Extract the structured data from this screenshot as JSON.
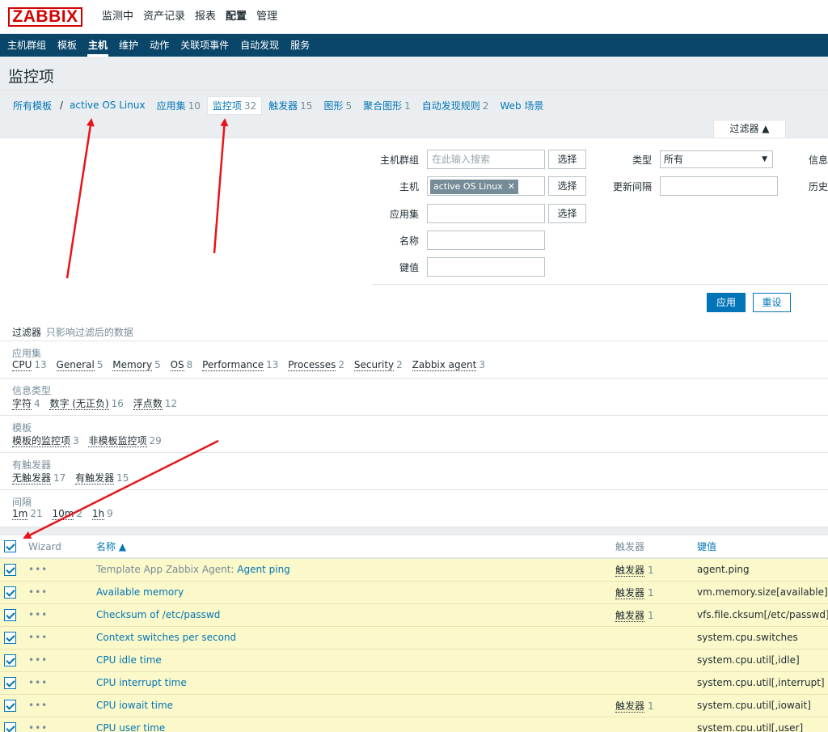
{
  "top": {
    "logo": "ZABBIX",
    "menu": [
      "监测中",
      "资产记录",
      "报表",
      "配置",
      "管理"
    ],
    "selected_menu": "配置"
  },
  "subnav": {
    "items": [
      "主机群组",
      "模板",
      "主机",
      "维护",
      "动作",
      "关联项事件",
      "自动发现",
      "服务"
    ],
    "selected": "主机"
  },
  "page": {
    "title": "监控项"
  },
  "breadcrumbs": {
    "all_templates": "所有模板",
    "separator": "/",
    "host": "active OS Linux",
    "tabs": [
      {
        "label": "应用集",
        "count": "10"
      },
      {
        "label": "监控项",
        "count": "32"
      },
      {
        "label": "触发器",
        "count": "15"
      },
      {
        "label": "图形",
        "count": "5"
      },
      {
        "label": "聚合图形",
        "count": "1"
      },
      {
        "label": "自动发现规则",
        "count": "2"
      },
      {
        "label": "Web 场景",
        "count": ""
      }
    ]
  },
  "filter": {
    "tab_label": "过滤器 ▲",
    "host_group_label": "主机群组",
    "host_group_placeholder": "在此输入搜索",
    "select_label": "选择",
    "host_label": "主机",
    "host_tag": "active OS Linux",
    "app_label": "应用集",
    "name_label": "名称",
    "key_label": "键值",
    "type_label": "类型",
    "type_value": "所有",
    "interval_label": "更新间隔",
    "info_label_cut": "信息",
    "history_label_cut": "历史",
    "apply": "应用",
    "reset": "重设"
  },
  "subfilter": {
    "title": "过滤器",
    "note": "只影响过滤后的数据",
    "groups": [
      {
        "label": "应用集",
        "items": [
          {
            "name": "CPU",
            "count": "13"
          },
          {
            "name": "General",
            "count": "5"
          },
          {
            "name": "Memory",
            "count": "5"
          },
          {
            "name": "OS",
            "count": "8"
          },
          {
            "name": "Performance",
            "count": "13"
          },
          {
            "name": "Processes",
            "count": "2"
          },
          {
            "name": "Security",
            "count": "2"
          },
          {
            "name": "Zabbix agent",
            "count": "3"
          }
        ]
      },
      {
        "label": "信息类型",
        "items": [
          {
            "name": "字符",
            "count": "4"
          },
          {
            "name": "数字 (无正负)",
            "count": "16"
          },
          {
            "name": "浮点数",
            "count": "12"
          }
        ]
      },
      {
        "label": "模板",
        "items": [
          {
            "name": "模板的监控项",
            "count": "3"
          },
          {
            "name": "非模板监控项",
            "count": "29"
          }
        ]
      },
      {
        "label": "有触发器",
        "items": [
          {
            "name": "无触发器",
            "count": "17"
          },
          {
            "name": "有触发器",
            "count": "15"
          }
        ]
      },
      {
        "label": "间隔",
        "items": [
          {
            "name": "1m",
            "count": "21"
          },
          {
            "name": "10m",
            "count": "2"
          },
          {
            "name": "1h",
            "count": "9"
          }
        ]
      }
    ]
  },
  "table": {
    "headers": {
      "wizard": "Wizard",
      "name": "名称 ▲",
      "triggers": "触发器",
      "key": "键值"
    },
    "rows": [
      {
        "template": "Template App Zabbix Agent:",
        "name": "Agent ping",
        "trigger": "触发器",
        "trigger_count": "1",
        "key": "agent.ping"
      },
      {
        "template": "",
        "name": "Available memory",
        "trigger": "触发器",
        "trigger_count": "1",
        "key": "vm.memory.size[available]"
      },
      {
        "template": "",
        "name": "Checksum of /etc/passwd",
        "trigger": "触发器",
        "trigger_count": "1",
        "key": "vfs.file.cksum[/etc/passwd]"
      },
      {
        "template": "",
        "name": "Context switches per second",
        "trigger": "",
        "trigger_count": "",
        "key": "system.cpu.switches"
      },
      {
        "template": "",
        "name": "CPU idle time",
        "trigger": "",
        "trigger_count": "",
        "key": "system.cpu.util[,idle]"
      },
      {
        "template": "",
        "name": "CPU interrupt time",
        "trigger": "",
        "trigger_count": "",
        "key": "system.cpu.util[,interrupt]"
      },
      {
        "template": "",
        "name": "CPU iowait time",
        "trigger": "触发器",
        "trigger_count": "1",
        "key": "system.cpu.util[,iowait]"
      },
      {
        "template": "",
        "name": "CPU user time",
        "trigger": "",
        "trigger_count": "",
        "key": "system.cpu.util[,user]"
      }
    ]
  },
  "annotation_color": "#e8141b"
}
